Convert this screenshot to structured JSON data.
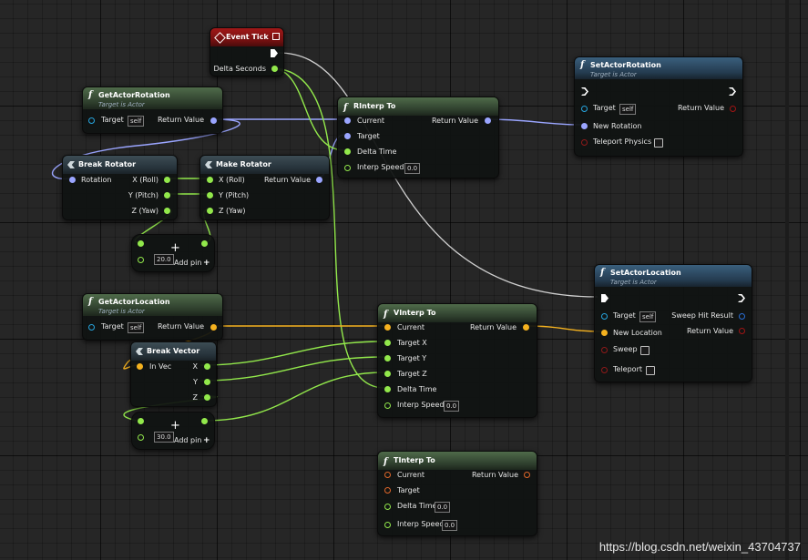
{
  "common": {
    "target_is_actor": "Target is Actor",
    "target": "Target",
    "self": "self",
    "return_value": "Return Value",
    "add_pin": "Add pin"
  },
  "event_tick": {
    "title": "Event Tick",
    "delta_seconds": "Delta Seconds"
  },
  "get_actor_rotation": {
    "title": "GetActorRotation"
  },
  "break_rotator": {
    "title": "Break Rotator",
    "rotation": "Rotation",
    "x": "X (Roll)",
    "y": "Y (Pitch)",
    "z": "Z (Yaw)"
  },
  "make_rotator": {
    "title": "Make Rotator",
    "x": "X (Roll)",
    "y": "Y (Pitch)",
    "z": "Z (Yaw)"
  },
  "add_node_1": {
    "value": "20.0"
  },
  "rinterp": {
    "title": "RInterp To",
    "current": "Current",
    "target": "Target",
    "delta_time": "Delta Time",
    "interp_speed": "Interp Speed",
    "interp_speed_value": "0.0"
  },
  "set_actor_rotation": {
    "title": "SetActorRotation",
    "new_rotation": "New Rotation",
    "teleport_physics": "Teleport Physics"
  },
  "get_actor_location": {
    "title": "GetActorLocation"
  },
  "break_vector": {
    "title": "Break Vector",
    "in_vec": "In Vec",
    "x": "X",
    "y": "Y",
    "z": "Z"
  },
  "add_node_2": {
    "value": "30.0"
  },
  "vinterp": {
    "title": "VInterp To",
    "current": "Current",
    "target_x": "Target X",
    "target_y": "Target Y",
    "target_z": "Target Z",
    "delta_time": "Delta Time",
    "interp_speed": "Interp Speed",
    "interp_speed_value": "0.0"
  },
  "set_actor_location": {
    "title": "SetActorLocation",
    "new_location": "New Location",
    "sweep": "Sweep",
    "teleport": "Teleport",
    "sweep_hit_result": "Sweep Hit Result"
  },
  "tinterp": {
    "title": "TInterp To",
    "current": "Current",
    "target": "Target",
    "delta_time": "Delta Time",
    "delta_time_value": "0.0",
    "interp_speed": "Interp Speed",
    "interp_speed_value": "0.0"
  },
  "watermark": "https://blog.csdn.net/weixin_43704737",
  "colors": {
    "float": "#92e84b",
    "vector": "#f5b21f",
    "rotator": "#9aa5ff",
    "object": "#27a6e0",
    "exec": "#ffffff",
    "transform": "#e0672a",
    "bool": "#8f1a1a"
  }
}
